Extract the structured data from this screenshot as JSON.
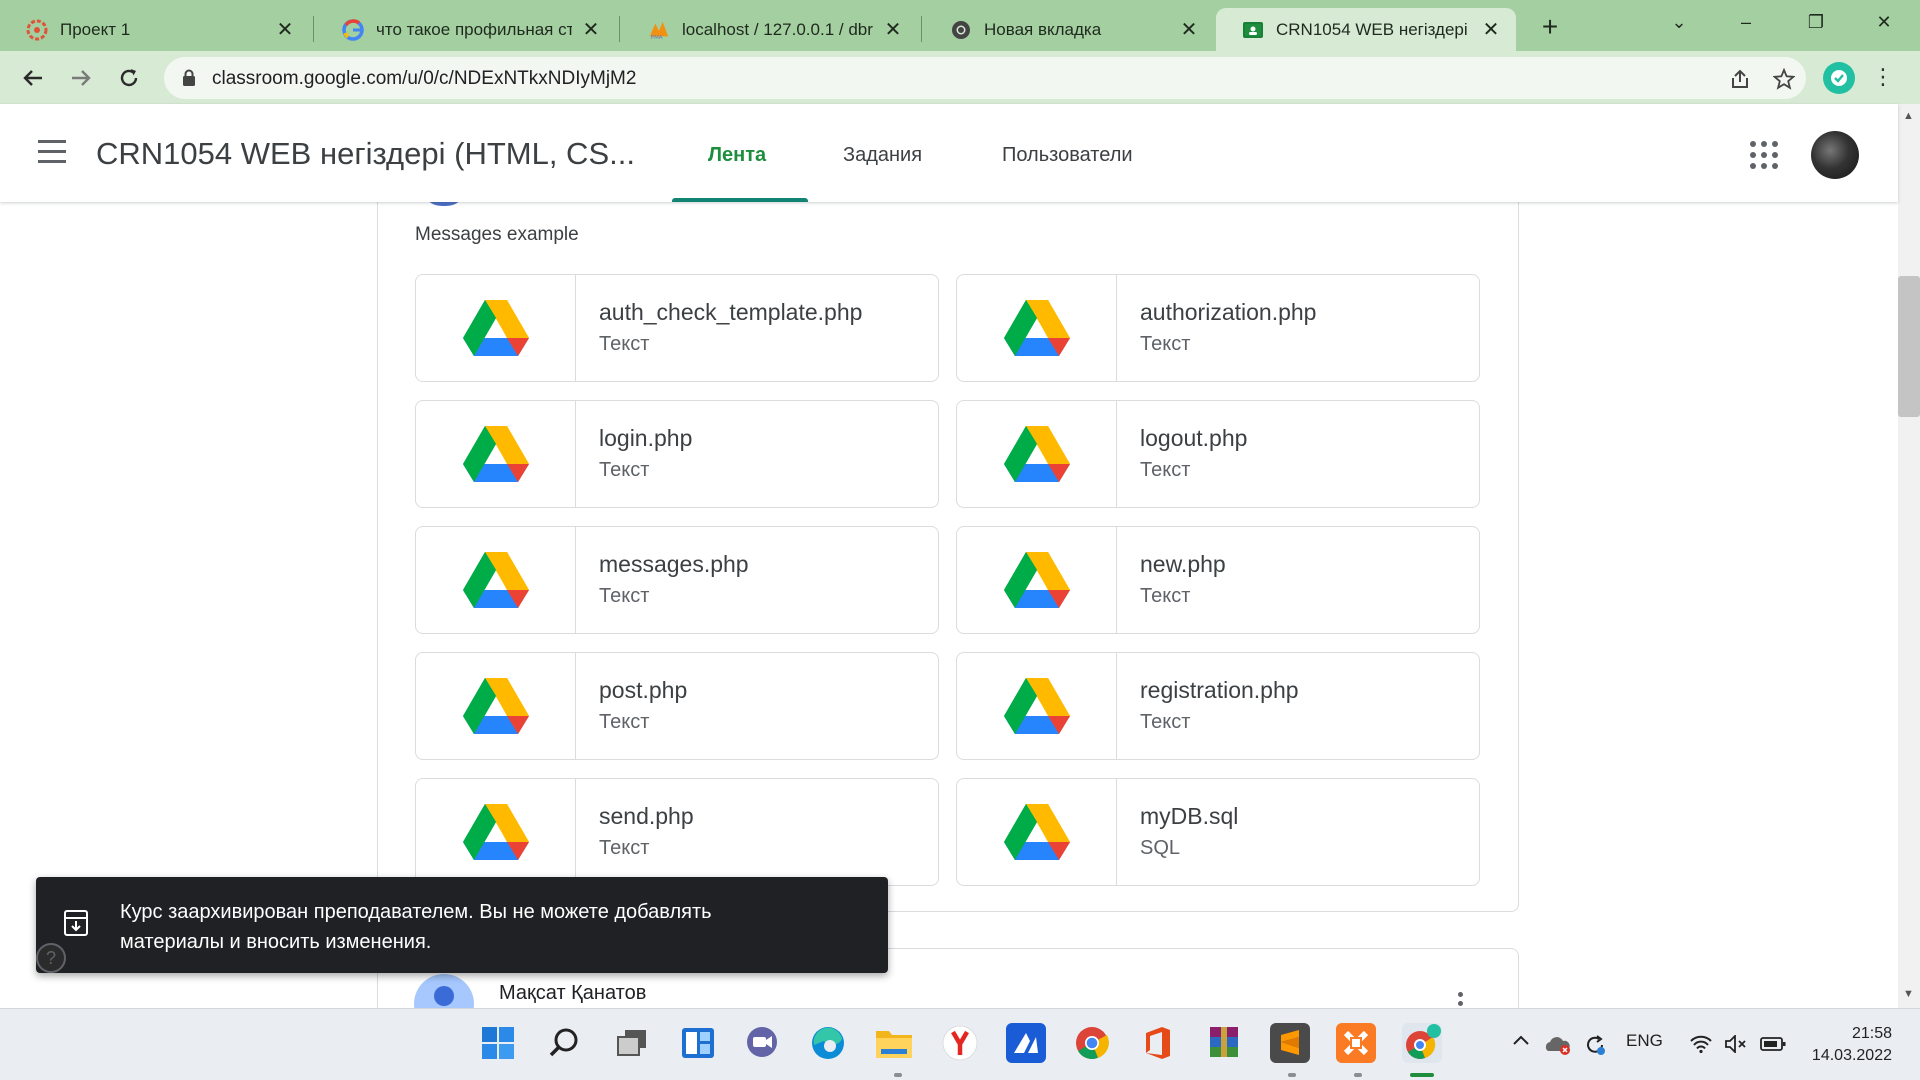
{
  "browser": {
    "tabs": [
      {
        "title": "Проект 1",
        "favicon": "figma-like-red-icon",
        "active": false
      },
      {
        "title": "что такое профильная ст",
        "favicon": "google-g-icon",
        "active": false
      },
      {
        "title": "localhost / 127.0.0.1 / dbr",
        "favicon": "phpmyadmin-icon",
        "active": false
      },
      {
        "title": "Новая вкладка",
        "favicon": "chrome-icon",
        "active": false
      },
      {
        "title": "CRN1054 WEB негіздері (",
        "favicon": "classroom-icon",
        "active": true
      }
    ],
    "new_tab": "+",
    "window_controls": {
      "minimize": "–",
      "restore": "❐",
      "close": "✕",
      "tab_search": "⌄"
    },
    "url": "classroom.google.com/u/0/c/NDExNTkxNDIyMjM2"
  },
  "classroom": {
    "course_title": "CRN1054 WEB негіздері (HTML, CS...",
    "tabs": [
      "Лента",
      "Задания",
      "Пользователи"
    ],
    "active_tab": "Лента"
  },
  "post": {
    "text": "Messages example",
    "attachments": [
      {
        "name": "auth_check_template.php",
        "type": "Текст"
      },
      {
        "name": "authorization.php",
        "type": "Текст"
      },
      {
        "name": "login.php",
        "type": "Текст"
      },
      {
        "name": "logout.php",
        "type": "Текст"
      },
      {
        "name": "messages.php",
        "type": "Текст"
      },
      {
        "name": "new.php",
        "type": "Текст"
      },
      {
        "name": "post.php",
        "type": "Текст"
      },
      {
        "name": "registration.php",
        "type": "Текст"
      },
      {
        "name": "send.php",
        "type": "Текст"
      },
      {
        "name": "myDB.sql",
        "type": "SQL"
      }
    ]
  },
  "next_post": {
    "author": "Мақсат Қанатов"
  },
  "snackbar": {
    "line1": "Курс заархивирован преподавателем. Вы не можете добавлять",
    "line2": "материалы и вносить изменения.",
    "help": "?"
  },
  "taskbar": {
    "apps": [
      "start",
      "search",
      "task-view",
      "widgets",
      "teams-chat",
      "edge",
      "file-explorer",
      "yandex-browser",
      "vs-code-like",
      "chrome",
      "office",
      "winrar",
      "sublime-text",
      "xampp",
      "chrome-profile"
    ],
    "tray": {
      "language": "ENG"
    },
    "time": "21:58",
    "date": "14.03.2022"
  },
  "colors": {
    "tab_bar": "#a4cfa0",
    "classroom_accent": "#1e8e3e",
    "snackbar": "#202124"
  }
}
